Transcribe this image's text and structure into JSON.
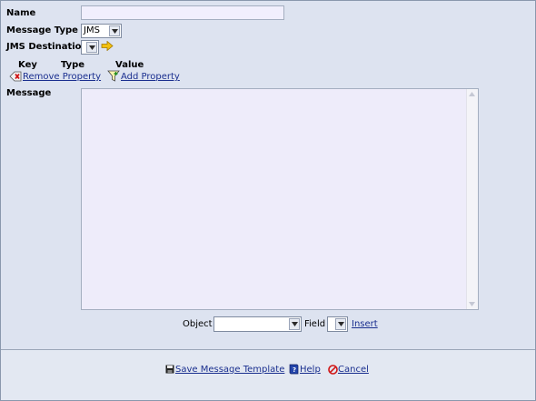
{
  "form": {
    "name_label": "Name",
    "name_value": "",
    "message_type_label": "Message Type",
    "message_type_value": "JMS",
    "jms_destination_label": "JMS Destination",
    "jms_destination_value": "",
    "properties": {
      "col_key": "Key",
      "col_type": "Type",
      "col_value": "Value",
      "remove_label": "Remove Property",
      "add_label": "Add Property"
    },
    "message_label": "Message",
    "message_value": "",
    "object_label": "Object",
    "object_value": "",
    "field_label": "Field",
    "field_value": "",
    "insert_label": "Insert"
  },
  "footer": {
    "save_label": "Save Message Template",
    "help_label": "Help",
    "cancel_label": "Cancel"
  },
  "icons": {
    "arrow": "arrow-right-icon",
    "remove": "remove-property-icon",
    "add": "add-property-icon",
    "save": "save-disk-icon",
    "help": "help-book-icon",
    "cancel": "cancel-circle-icon"
  },
  "colors": {
    "background": "#dde3f0",
    "link": "#1a2f8f",
    "input_bg": "#f1effd"
  }
}
